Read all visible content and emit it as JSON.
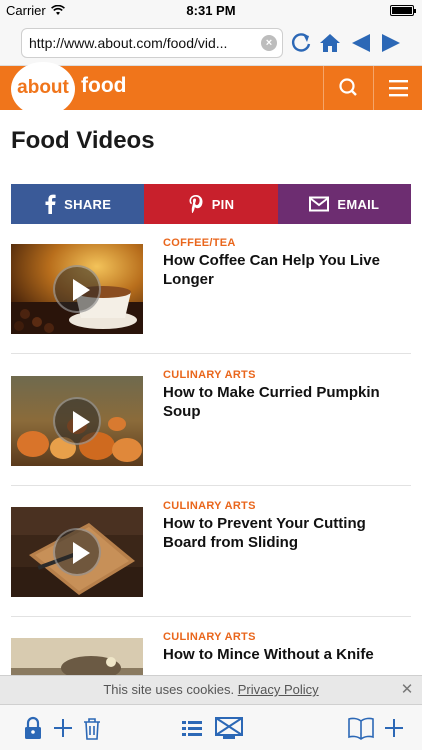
{
  "status_bar": {
    "carrier": "Carrier",
    "time": "8:31 PM"
  },
  "browser": {
    "url": "http://www.about.com/food/vid..."
  },
  "site": {
    "logo_text": "about",
    "section": "food"
  },
  "page": {
    "title": "Food Videos"
  },
  "share": {
    "facebook": "SHARE",
    "pinterest": "PIN",
    "email": "EMAIL"
  },
  "articles": [
    {
      "category": "COFFEE/TEA",
      "title": "How Coffee Can Help You Live Longer"
    },
    {
      "category": "CULINARY ARTS",
      "title": "How to Make Curried Pumpkin Soup"
    },
    {
      "category": "CULINARY ARTS",
      "title": "How to Prevent Your Cutting Board from Sliding"
    },
    {
      "category": "CULINARY ARTS",
      "title": "How to Mince Without a Knife"
    }
  ],
  "cookie": {
    "text": "This site uses cookies.",
    "link": "Privacy Policy",
    "close": "✕"
  },
  "colors": {
    "brand": "#f0751b",
    "facebook": "#3a5a98",
    "pinterest": "#c8202c",
    "email": "#6d2d71",
    "category": "#e9661c",
    "icons": "#2c68b6"
  }
}
